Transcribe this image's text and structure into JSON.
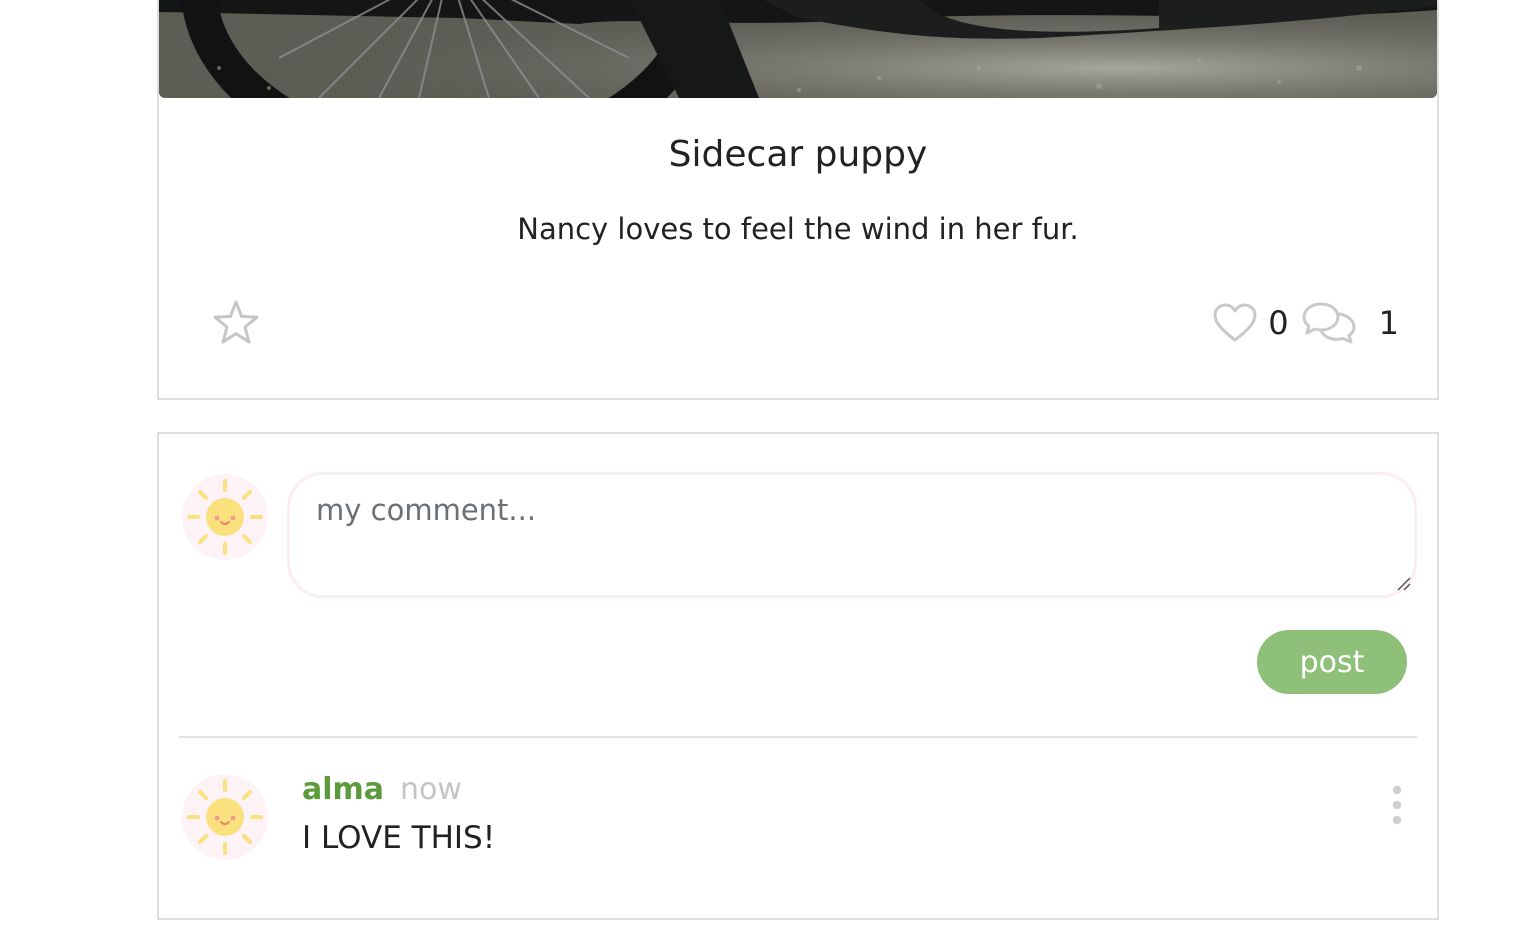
{
  "post": {
    "title": "Sidecar puppy",
    "caption": "Nancy loves to feel the wind in her fur.",
    "likes_count": "0",
    "comments_count": "1"
  },
  "composer": {
    "placeholder": "my comment...",
    "submit_label": "post"
  },
  "comments": [
    {
      "author": "alma",
      "time": "now",
      "text": "I LOVE THIS!"
    }
  ],
  "colors": {
    "accent_green": "#5c9a3c",
    "button_green": "#8fc07a",
    "card_border": "#dedede",
    "avatar_background": "#fdf3f6",
    "sun_yellow": "#fbe07e"
  },
  "icons": {
    "favorite": "star-outline-icon",
    "likes": "heart-outline-icon",
    "comments": "speech-bubbles-icon",
    "avatar": "sun-face-icon",
    "more": "vertical-dots-icon"
  }
}
